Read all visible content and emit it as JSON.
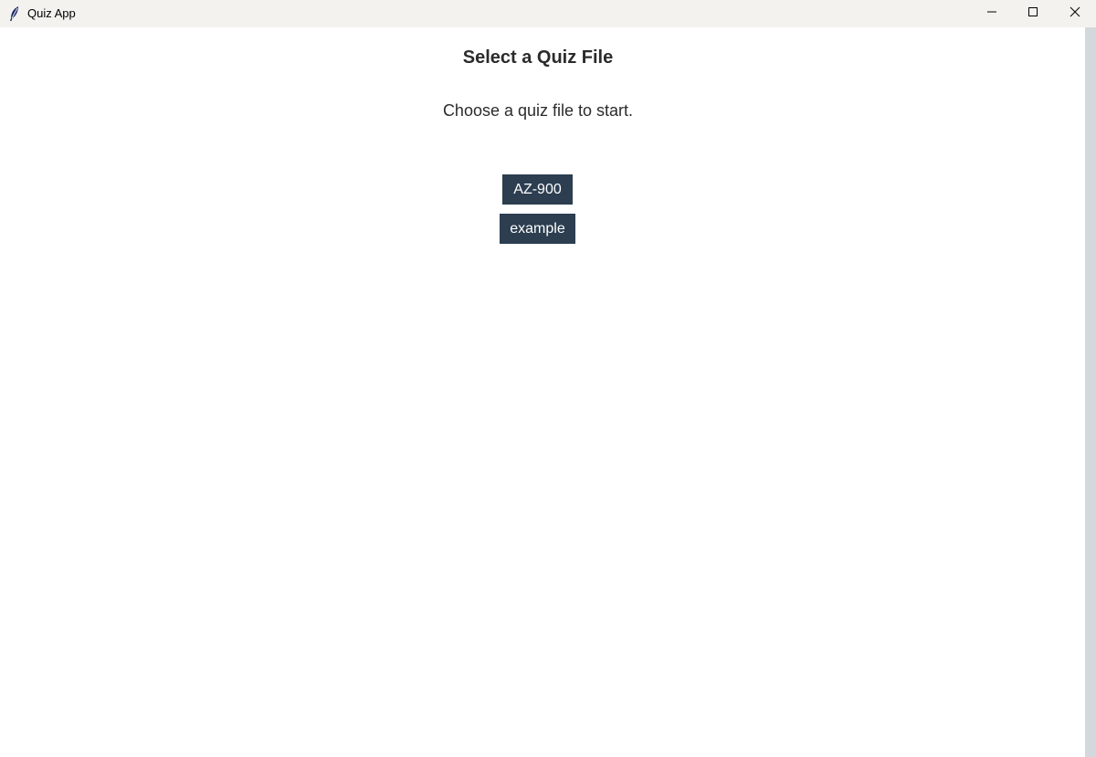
{
  "window": {
    "title": "Quiz App"
  },
  "main": {
    "heading": "Select a Quiz File",
    "subtitle": "Choose a quiz file to start.",
    "quiz_files": [
      {
        "label": "AZ-900"
      },
      {
        "label": "example"
      }
    ]
  },
  "colors": {
    "button_bg": "#2c3e50",
    "titlebar_bg": "#f3f2ee",
    "scrollbar": "#d3d8dc"
  },
  "icons": {
    "app": "feather-icon",
    "minimize": "minimize-icon",
    "maximize": "maximize-icon",
    "close": "close-icon"
  }
}
